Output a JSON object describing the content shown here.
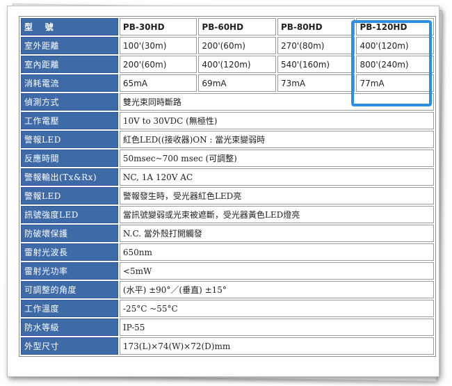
{
  "header": {
    "label": "型　 號",
    "models": [
      "PB-30HD",
      "PB-60HD",
      "PB-80HD",
      "PB-120HD"
    ]
  },
  "comparison_rows": [
    {
      "label": "室外距離",
      "values": [
        "100'(30m)",
        "200'(60m)",
        "270'(80m)",
        "400'(120m)"
      ]
    },
    {
      "label": "室內距離",
      "values": [
        "200'(60m)",
        "400'(120m)",
        "540'(160m)",
        "800'(240m)"
      ]
    },
    {
      "label": "消耗電流",
      "values": [
        "65mA",
        "69mA",
        "73mA",
        "77mA"
      ]
    }
  ],
  "spec_rows": [
    {
      "label": "偵測方式",
      "value": "雙光束同時斷路"
    },
    {
      "label": "工作電壓",
      "value": "10V to 30VDC (無極性)"
    },
    {
      "label": "警報LED",
      "value": "紅色LED((接收器)ON : 當光束變弱時"
    },
    {
      "label": "反應時間",
      "value": "50msec~700 msec (可調整)"
    },
    {
      "label": "警報輸出(Tx&Rx)",
      "value": "NC, 1A 120V AC"
    },
    {
      "label": "警報LED",
      "value": "警報發生時，受光器紅色LED亮"
    },
    {
      "label": "訊號強度LED",
      "value": "當訊號變弱或光束被遮斷，受光器黃色LED燈亮"
    },
    {
      "label": "防破壞保護",
      "value": "N.C. 當外殼打開觸發"
    },
    {
      "label": "雷射光波長",
      "value": "650nm"
    },
    {
      "label": "雷射光功率",
      "value": "<5mW"
    },
    {
      "label": "可調整的角度",
      "value": "(水平) ±90°／(垂直) ±15°"
    },
    {
      "label": "工作溫度",
      "value": "-25°C ~55°C"
    },
    {
      "label": "防水等級",
      "value": "IP-55"
    },
    {
      "label": "外型尺寸",
      "value": "173(L)×74(W)×72(D)mm"
    }
  ],
  "colors": {
    "label_bg": "#3e6aa8",
    "model_text": "#1f3f8f",
    "highlight_border": "#2a8fe6"
  }
}
